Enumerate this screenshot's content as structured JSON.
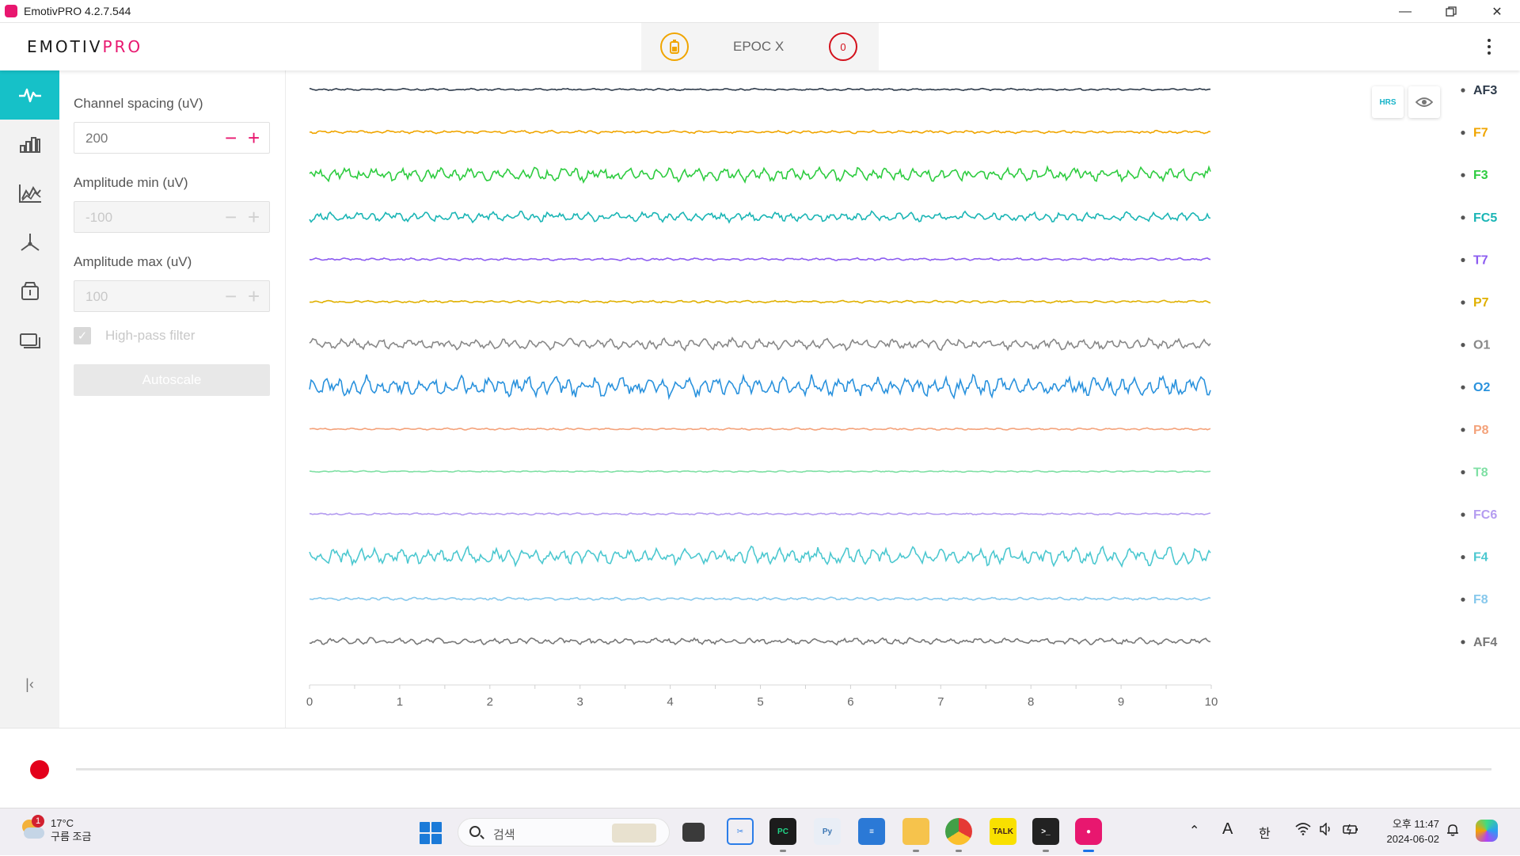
{
  "window": {
    "title": "EmotivPRO 4.2.7.544"
  },
  "header": {
    "logo_main": "EMOTIV",
    "logo_pro": "PRO",
    "headset_name": "EPOC X",
    "contact_quality": "0"
  },
  "nav": {
    "items": [
      "raw-data",
      "band-power",
      "performance-metrics",
      "motion",
      "recordings",
      "devices"
    ]
  },
  "settings": {
    "channel_spacing_label": "Channel spacing (uV)",
    "channel_spacing_value": "200",
    "amp_min_label": "Amplitude min (uV)",
    "amp_min_value": "-100",
    "amp_max_label": "Amplitude max (uV)",
    "amp_max_value": "100",
    "highpass_label": "High-pass filter",
    "highpass_checked": true,
    "autoscale_label": "Autoscale",
    "minus": "−",
    "plus": "+"
  },
  "plot": {
    "hrs_label": "HRS"
  },
  "chart_data": {
    "type": "line",
    "x": [
      0,
      10
    ],
    "xlim": [
      0,
      10
    ],
    "xticks": [
      "0",
      "1",
      "2",
      "3",
      "4",
      "5",
      "6",
      "7",
      "8",
      "9",
      "10"
    ],
    "channel_spacing_uV": 200,
    "series": [
      {
        "name": "AF3",
        "color": "#2d3a4a",
        "amplitude_uV": 4
      },
      {
        "name": "F7",
        "color": "#f0a500",
        "amplitude_uV": 6
      },
      {
        "name": "F3",
        "color": "#2ecc40",
        "amplitude_uV": 28
      },
      {
        "name": "FC5",
        "color": "#1ab5b5",
        "amplitude_uV": 20
      },
      {
        "name": "T7",
        "color": "#8c5cf0",
        "amplitude_uV": 5
      },
      {
        "name": "P7",
        "color": "#e0b000",
        "amplitude_uV": 5
      },
      {
        "name": "O1",
        "color": "#888888",
        "amplitude_uV": 22
      },
      {
        "name": "O2",
        "color": "#2a92dd",
        "amplitude_uV": 42
      },
      {
        "name": "P8",
        "color": "#f4a27a",
        "amplitude_uV": 4
      },
      {
        "name": "T8",
        "color": "#7fe0a4",
        "amplitude_uV": 3
      },
      {
        "name": "FC6",
        "color": "#b49cf0",
        "amplitude_uV": 4
      },
      {
        "name": "F4",
        "color": "#4cc8d0",
        "amplitude_uV": 36
      },
      {
        "name": "F8",
        "color": "#86c8ec",
        "amplitude_uV": 6
      },
      {
        "name": "AF4",
        "color": "#777777",
        "amplitude_uV": 14
      }
    ]
  },
  "taskbar": {
    "weather_temp": "17°C",
    "weather_desc": "구름 조금",
    "weather_alert": "1",
    "search_placeholder": "검색",
    "ime_a": "A",
    "ime_han": "한",
    "time": "오후 11:47",
    "date": "2024-06-02"
  }
}
